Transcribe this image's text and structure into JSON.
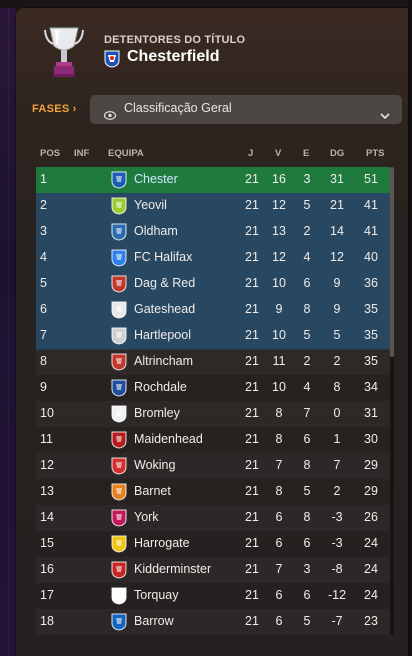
{
  "header": {
    "holders_label": "DETENTORES DO TÍTULO",
    "holder_club": "Chesterfield"
  },
  "stage": {
    "label": "FASES",
    "chevron": "›",
    "selected": "Classificação Geral"
  },
  "columns": {
    "pos": "POS",
    "inf": "INF",
    "team": "EQUIPA",
    "played": "J",
    "won": "V",
    "drawn": "E",
    "gd": "DG",
    "pts": "PTS"
  },
  "colors": {
    "champion_row": "#1f7a3d",
    "promotion_row": "#284760",
    "accent": "#f2a43a"
  },
  "rows": [
    {
      "pos": "1",
      "team": "Chester",
      "played": "21",
      "won": "16",
      "drawn": "3",
      "gd": "31",
      "pts": "51",
      "zone": "champ",
      "badge": "#1a5fb4"
    },
    {
      "pos": "2",
      "team": "Yeovil",
      "played": "21",
      "won": "12",
      "drawn": "5",
      "gd": "21",
      "pts": "41",
      "zone": "promo",
      "badge": "#9acd32"
    },
    {
      "pos": "3",
      "team": "Oldham",
      "played": "21",
      "won": "13",
      "drawn": "2",
      "gd": "14",
      "pts": "41",
      "zone": "promo",
      "badge": "#2b6cb0"
    },
    {
      "pos": "4",
      "team": "FC Halifax",
      "played": "21",
      "won": "12",
      "drawn": "4",
      "gd": "12",
      "pts": "40",
      "zone": "promo",
      "badge": "#2f80ed"
    },
    {
      "pos": "5",
      "team": "Dag & Red",
      "played": "21",
      "won": "10",
      "drawn": "6",
      "gd": "9",
      "pts": "36",
      "zone": "promo",
      "badge": "#c0392b"
    },
    {
      "pos": "6",
      "team": "Gateshead",
      "played": "21",
      "won": "9",
      "drawn": "8",
      "gd": "9",
      "pts": "35",
      "zone": "promo",
      "badge": "#e8e8e8"
    },
    {
      "pos": "7",
      "team": "Hartlepool",
      "played": "21",
      "won": "10",
      "drawn": "5",
      "gd": "5",
      "pts": "35",
      "zone": "promo",
      "badge": "#d0d0d0"
    },
    {
      "pos": "8",
      "team": "Altrincham",
      "played": "21",
      "won": "11",
      "drawn": "2",
      "gd": "2",
      "pts": "35",
      "zone": "",
      "badge": "#c0392b"
    },
    {
      "pos": "9",
      "team": "Rochdale",
      "played": "21",
      "won": "10",
      "drawn": "4",
      "gd": "8",
      "pts": "34",
      "zone": "",
      "badge": "#1f4e9c"
    },
    {
      "pos": "10",
      "team": "Bromley",
      "played": "21",
      "won": "8",
      "drawn": "7",
      "gd": "0",
      "pts": "31",
      "zone": "",
      "badge": "#f0f0f0"
    },
    {
      "pos": "11",
      "team": "Maidenhead",
      "played": "21",
      "won": "8",
      "drawn": "6",
      "gd": "1",
      "pts": "30",
      "zone": "",
      "badge": "#b71c1c"
    },
    {
      "pos": "12",
      "team": "Woking",
      "played": "21",
      "won": "7",
      "drawn": "8",
      "gd": "7",
      "pts": "29",
      "zone": "",
      "badge": "#d32f2f"
    },
    {
      "pos": "13",
      "team": "Barnet",
      "played": "21",
      "won": "8",
      "drawn": "5",
      "gd": "2",
      "pts": "29",
      "zone": "",
      "badge": "#e67e22"
    },
    {
      "pos": "14",
      "team": "York",
      "played": "21",
      "won": "6",
      "drawn": "8",
      "gd": "-3",
      "pts": "26",
      "zone": "",
      "badge": "#c2185b"
    },
    {
      "pos": "15",
      "team": "Harrogate",
      "played": "21",
      "won": "6",
      "drawn": "6",
      "gd": "-3",
      "pts": "24",
      "zone": "",
      "badge": "#f1c40f"
    },
    {
      "pos": "16",
      "team": "Kidderminster",
      "played": "21",
      "won": "7",
      "drawn": "3",
      "gd": "-8",
      "pts": "24",
      "zone": "",
      "badge": "#c62828"
    },
    {
      "pos": "17",
      "team": "Torquay",
      "played": "21",
      "won": "6",
      "drawn": "6",
      "gd": "-12",
      "pts": "24",
      "zone": "",
      "badge": "#ffffff"
    },
    {
      "pos": "18",
      "team": "Barrow",
      "played": "21",
      "won": "6",
      "drawn": "5",
      "gd": "-7",
      "pts": "23",
      "zone": "",
      "badge": "#1565c0"
    }
  ]
}
